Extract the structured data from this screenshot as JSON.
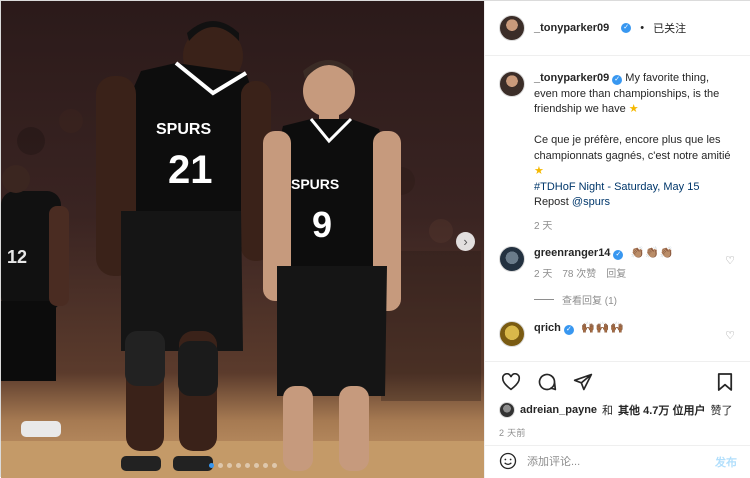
{
  "header": {
    "username": "_tonyparker09",
    "separator": "•",
    "follow_label": "已关注"
  },
  "caption": {
    "username": "_tonyparker09",
    "text_en": "My favorite thing, even more than championships, is the friendship we have",
    "text_fr": "Ce que je préfère, encore plus que les championnats gagnés, c'est notre amitié",
    "hashtag_line": "#TDHoF Night - Saturday, May 15",
    "repost_label": "Repost",
    "repost_mention": "@spurs",
    "time": "2 天",
    "star": "★"
  },
  "comments": [
    {
      "username": "greenranger14",
      "emoji": "👏🏽👏🏽👏🏽",
      "time": "2 天",
      "likes": "78 次赞",
      "reply_label": "回复",
      "view_replies": "查看回复 (1)"
    },
    {
      "username": "qrich",
      "emoji": "🙌🏾🙌🏾🙌🏾"
    }
  ],
  "likes": {
    "user": "adreian_payne",
    "mid": "和",
    "others": "其他 4.7万 位用户",
    "suffix": "赞了"
  },
  "age": "2 天前",
  "comment_box": {
    "placeholder": "添加评论...",
    "post_label": "发布"
  },
  "photo": {
    "jersey_left": "21",
    "jersey_right": "9",
    "jersey_back": "12",
    "team_text": "SPURS"
  },
  "icons": [
    "heart-icon",
    "comment-icon",
    "share-icon",
    "bookmark-icon",
    "emoji-icon",
    "chevron-right-icon",
    "verified-icon"
  ],
  "colors": {
    "link": "#00376b",
    "verified": "#3897f0",
    "muted": "#8e8e8e",
    "post_button": "#b2dffc"
  }
}
